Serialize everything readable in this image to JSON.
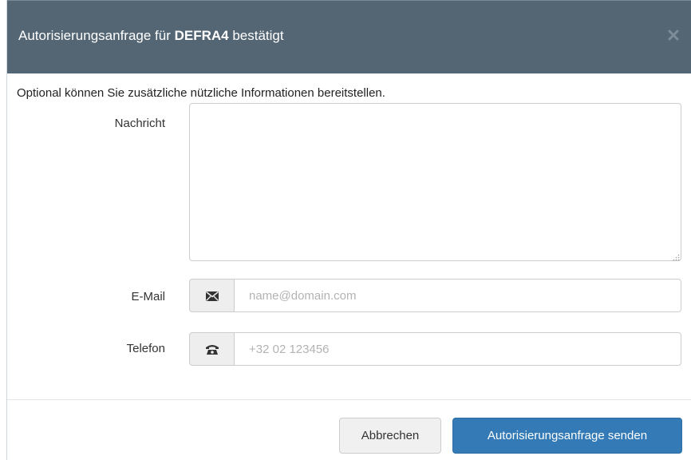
{
  "dialog": {
    "title_prefix": "Autorisierungsanfrage für ",
    "title_strong": "DEFRA4",
    "title_suffix": " bestätigt",
    "close_icon": "close-icon",
    "intro": "Optional können Sie zusätzliche nützliche Informationen bereitstellen."
  },
  "form": {
    "message_label": "Nachricht",
    "message_value": "",
    "email_label": "E-Mail",
    "email_icon": "envelope-icon",
    "email_placeholder": "name@domain.com",
    "phone_label": "Telefon",
    "phone_icon": "phone-icon",
    "phone_placeholder": "+32 02 123456"
  },
  "footer": {
    "cancel_label": "Abbrechen",
    "submit_label": "Autorisierungsanfrage senden"
  },
  "colors": {
    "header_bg": "#546673",
    "primary": "#337ab7",
    "addon_bg": "#eeeeee"
  }
}
